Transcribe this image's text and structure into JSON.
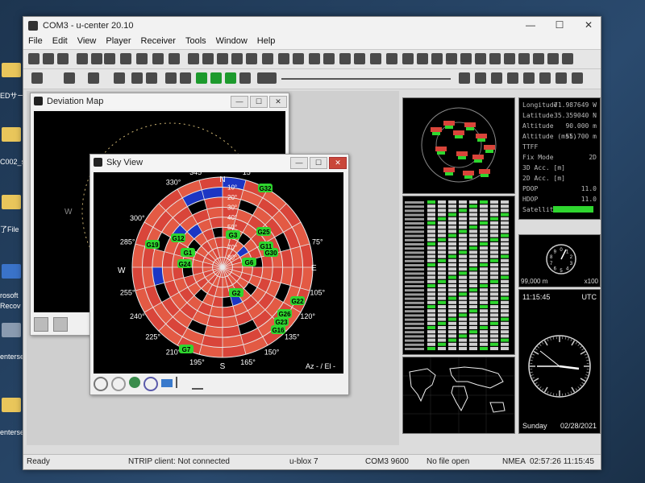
{
  "desktop": {
    "labels": [
      "EDサー",
      "C002_s",
      "了File",
      "rosoft",
      "Recov",
      "enterse",
      "enterse"
    ]
  },
  "app": {
    "title": "COM3 - u-center 20.10",
    "menu": [
      "File",
      "Edit",
      "View",
      "Player",
      "Receiver",
      "Tools",
      "Window",
      "Help"
    ]
  },
  "deviation_map": {
    "title": "Deviation Map",
    "axis_w": "W"
  },
  "sky_view": {
    "title": "Sky View",
    "azimuth_labels": [
      "345°",
      "15°",
      "330°",
      "300°",
      "285°",
      "75°",
      "255°",
      "105°",
      "240°",
      "120°",
      "225°",
      "135°",
      "210°",
      "195°",
      "165°",
      "150°"
    ],
    "compass": {
      "north": "N",
      "east": "E",
      "south": "S",
      "west": "W"
    },
    "elevation_labels": [
      "10°",
      "20°",
      "30°",
      "40°",
      "50°",
      "60°",
      "70°",
      "80°"
    ],
    "satellites": [
      "G32",
      "G19",
      "G12",
      "G3",
      "G25",
      "G30",
      "G1",
      "G11",
      "G24",
      "G6",
      "G2",
      "G22",
      "G7",
      "G16",
      "G23",
      "G26"
    ],
    "footer_label": "Az - / El -",
    "bottom_toolbar_icons": [
      "target-icon",
      "circle-icon",
      "globe-icon",
      "refresh-icon",
      "satellite-icon",
      "antenna-icon",
      "signal-icon"
    ]
  },
  "data_view": {
    "rows": [
      {
        "label": "Longitude",
        "value": "71.987649 W"
      },
      {
        "label": "Latitude",
        "value": "35.359040 N"
      },
      {
        "label": "Altitude",
        "value": "90.000 m"
      },
      {
        "label": "Altitude (msl)",
        "value": "55.700 m"
      },
      {
        "label": "TTFF",
        "value": ""
      },
      {
        "label": "Fix Mode",
        "value": "2D"
      },
      {
        "label": "3D Acc. [m]",
        "value": ""
      },
      {
        "label": "2D Acc. [m]",
        "value": ""
      },
      {
        "label": "PDOP",
        "value": "11.0"
      },
      {
        "label": "HDOP",
        "value": "11.0"
      },
      {
        "label": "Satellites",
        "value": ""
      }
    ]
  },
  "altimeter": {
    "reading": "99,000 m",
    "scale": "x100",
    "digits": [
      "0",
      "1",
      "2",
      "3",
      "4",
      "5",
      "6",
      "7",
      "8",
      "9"
    ]
  },
  "clock": {
    "time": "11:15:45",
    "zone": "UTC",
    "day": "Sunday",
    "date": "02/28/2021"
  },
  "status_bar": {
    "ready": "Ready",
    "ntrip": "NTRIP client: Not connected",
    "receiver": "u-blox 7",
    "port": "COM3 9600",
    "file": "No file open",
    "protocol": "NMEA",
    "time": "02:57:26 11:15:45"
  },
  "colors": {
    "sky_cell": "#d9453a",
    "sky_cell_alt": "#e35a44",
    "sky_blue": "#1c36c4",
    "sat_label": "#2fd62f",
    "ring": "#e8e8e8",
    "background": "#000000"
  }
}
